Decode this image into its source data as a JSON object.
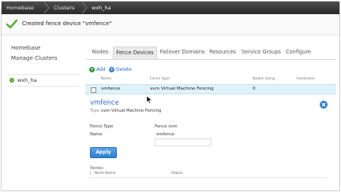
{
  "breadcrumb": {
    "items": [
      "Homebase",
      "Clusters",
      "wxh_ha"
    ]
  },
  "notification": {
    "message": "Created fence device \"vmfence\"",
    "icon": "checkmark-icon"
  },
  "sidebar": {
    "links": [
      "Homebase",
      "Manage Clusters"
    ],
    "cluster": {
      "name": "wxh_ha",
      "status_color": "#6fbf3b"
    }
  },
  "tabs": [
    "Nodes",
    "Fence Devices",
    "Failover Domains",
    "Resources",
    "Service Groups",
    "Configure"
  ],
  "active_tab": "Fence Devices",
  "toolbar": {
    "add": "Add",
    "delete": "Delete"
  },
  "table": {
    "headers": [
      "Name",
      "Fence Type",
      "Nodes Using",
      "Hostname"
    ],
    "rows": [
      {
        "name": "vmfence",
        "type": "xvm Virtual Machine Fencing",
        "nodes_using": "0",
        "hostname": ""
      }
    ]
  },
  "detail": {
    "title": "vmfence",
    "type_label": "Type",
    "type_value": "xvm Virtual Machine Fencing",
    "fields": [
      {
        "label": "Fence Type",
        "value": "Fence xvm"
      },
      {
        "label": "Name",
        "value": "vmfence"
      }
    ],
    "apply": "Apply",
    "nodes_title": "Nodes",
    "nodes_headers": [
      "Node Name",
      "Status"
    ]
  },
  "colors": {
    "accent": "#2a6ad6",
    "selected_row": "#dff2fb",
    "topbar": "#3a3a3a"
  }
}
